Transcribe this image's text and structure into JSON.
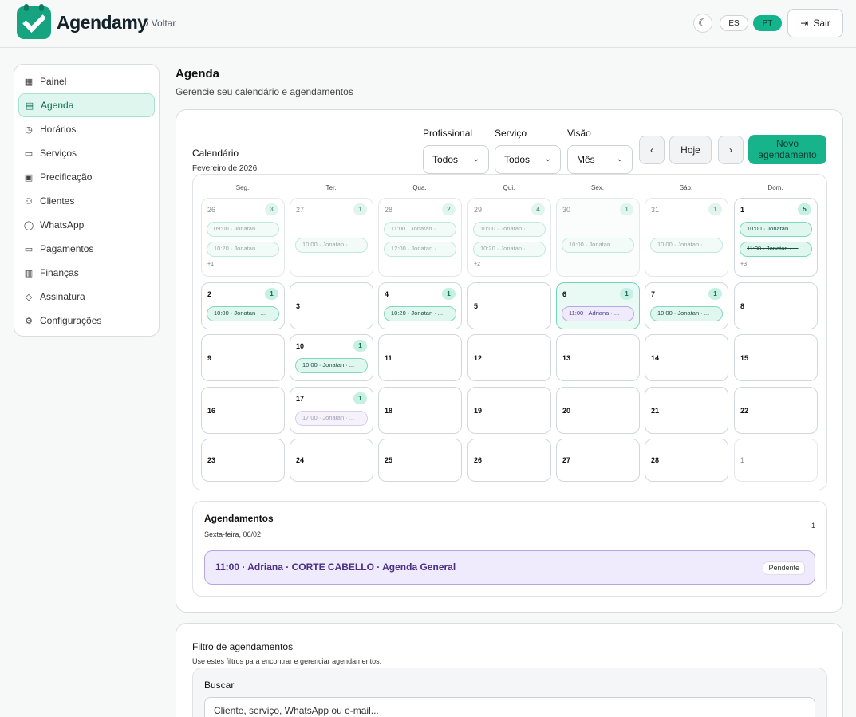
{
  "header": {
    "brand": "Agendamy",
    "back_link": "/ Voltar",
    "theme_icon": "moon-icon",
    "languages": [
      "ES",
      "PT"
    ],
    "active_language": "PT",
    "logout_label": "Sair",
    "accent_color": "#17b48c"
  },
  "sidebar": {
    "items": [
      {
        "label": "Painel",
        "icon": "grid-icon",
        "glyph": "▦"
      },
      {
        "label": "Agenda",
        "icon": "calendar-icon",
        "glyph": "▤",
        "active": true
      },
      {
        "label": "Horários",
        "icon": "clock-icon",
        "glyph": "◷"
      },
      {
        "label": "Serviços",
        "icon": "briefcase-icon",
        "glyph": "▭"
      },
      {
        "label": "Precificação",
        "icon": "calculator-icon",
        "glyph": "▣"
      },
      {
        "label": "Clientes",
        "icon": "users-icon",
        "glyph": "⚇"
      },
      {
        "label": "WhatsApp",
        "icon": "chat-icon",
        "glyph": "◯"
      },
      {
        "label": "Pagamentos",
        "icon": "credit-card-icon",
        "glyph": "▭"
      },
      {
        "label": "Finanças",
        "icon": "bar-chart-icon",
        "glyph": "▥"
      },
      {
        "label": "Assinatura",
        "icon": "diamond-icon",
        "glyph": "◇"
      },
      {
        "label": "Configurações",
        "icon": "gear-icon",
        "glyph": "⚙"
      }
    ]
  },
  "page": {
    "title": "Agenda",
    "subtitle": "Gerencie seu calendário e agendamentos"
  },
  "calendar": {
    "title": "Calendário",
    "month": "Fevereiro de 2026",
    "filters": [
      {
        "label": "Profissional",
        "value": "Todos"
      },
      {
        "label": "Serviço",
        "value": "Todos"
      },
      {
        "label": "Visão",
        "value": "Mês"
      }
    ],
    "prev_label": "‹",
    "today_label": "Hoje",
    "next_label": "›",
    "new_label": "Novo agendamento",
    "weekdays": [
      "Seg.",
      "Ter.",
      "Qua.",
      "Qui.",
      "Sex.",
      "Sáb.",
      "Dom."
    ],
    "weeks": [
      [
        {
          "day": "26",
          "outside": true,
          "count": "3",
          "more": "+1",
          "events": [
            {
              "text": "09:00 · Jonatan · ...",
              "faded": true
            },
            {
              "text": "10:20 · Jonatan · ...",
              "faded": true
            }
          ]
        },
        {
          "day": "27",
          "outside": true,
          "count": "1",
          "events": [
            {
              "text": "10:00 · Jonatan · ...",
              "faded": true
            }
          ]
        },
        {
          "day": "28",
          "outside": true,
          "count": "2",
          "events": [
            {
              "text": "11:00 · Jonatan · ...",
              "faded": true
            },
            {
              "text": "12:00 · Jonatan · ...",
              "faded": true
            }
          ]
        },
        {
          "day": "29",
          "outside": true,
          "count": "4",
          "more": "+2",
          "events": [
            {
              "text": "10:00 · Jonatan · ...",
              "faded": true
            },
            {
              "text": "10:20 · Jonatan · ...",
              "faded": true
            }
          ]
        },
        {
          "day": "30",
          "outside": true,
          "past": true,
          "count": "1",
          "events": [
            {
              "text": "10:00 · Jonatan · ...",
              "faded": true
            }
          ]
        },
        {
          "day": "31",
          "outside": true,
          "count": "1",
          "events": [
            {
              "text": "10:00 · Jonatan · ...",
              "faded": true
            }
          ]
        },
        {
          "day": "1",
          "count": "5",
          "more": "+3",
          "events": [
            {
              "text": "10:00 · Jonatan · ..."
            },
            {
              "text": "11:00 · Jonatan · ...",
              "strike": true
            }
          ]
        }
      ],
      [
        {
          "day": "2",
          "count": "1",
          "events": [
            {
              "text": "10:00 · Jonatan · ...",
              "strike": true
            }
          ]
        },
        {
          "day": "3"
        },
        {
          "day": "4",
          "count": "1",
          "events": [
            {
              "text": "10:20 · Jonatan · ...",
              "strike": true
            }
          ]
        },
        {
          "day": "5"
        },
        {
          "day": "6",
          "selected": true,
          "count": "1",
          "events": [
            {
              "text": "11:00 · Adriana · ...",
              "purple": true
            }
          ]
        },
        {
          "day": "7",
          "count": "1",
          "events": [
            {
              "text": "10:00 · Jonatan · ..."
            }
          ]
        },
        {
          "day": "8"
        }
      ],
      [
        {
          "day": "9"
        },
        {
          "day": "10",
          "count": "1",
          "events": [
            {
              "text": "10:00 · Jonatan · ..."
            }
          ]
        },
        {
          "day": "11"
        },
        {
          "day": "12"
        },
        {
          "day": "13"
        },
        {
          "day": "14"
        },
        {
          "day": "15"
        }
      ],
      [
        {
          "day": "16"
        },
        {
          "day": "17",
          "count": "1",
          "events": [
            {
              "text": "17:00 · Jonatan · ...",
              "purple": true,
              "faded": true
            }
          ]
        },
        {
          "day": "18"
        },
        {
          "day": "19"
        },
        {
          "day": "20"
        },
        {
          "day": "21"
        },
        {
          "day": "22"
        }
      ],
      [
        {
          "day": "23"
        },
        {
          "day": "24"
        },
        {
          "day": "25"
        },
        {
          "day": "26"
        },
        {
          "day": "27"
        },
        {
          "day": "28"
        },
        {
          "day": "1",
          "outside": true
        }
      ]
    ]
  },
  "appointments": {
    "title": "Agendamentos",
    "date": "Sexta-feira, 06/02",
    "count": "1",
    "items": [
      {
        "text": "11:00 · Adriana · CORTE CABELLO · Agenda General",
        "status": "Pendente"
      }
    ]
  },
  "filter_panel": {
    "title": "Filtro de agendamentos",
    "subtitle": "Use estes filtros para encontrar e gerenciar agendamentos.",
    "search_label": "Buscar",
    "search_placeholder": "Cliente, serviço, WhatsApp ou e-mail..."
  }
}
